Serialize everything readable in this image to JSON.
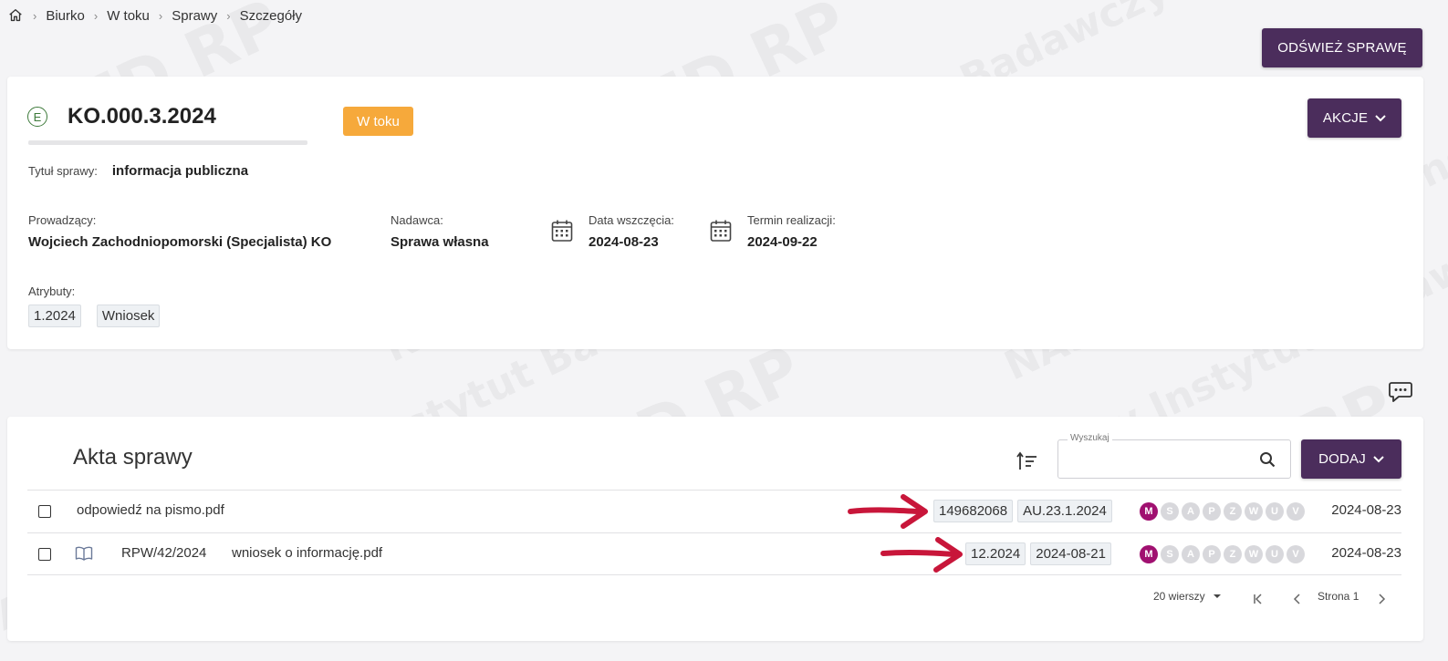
{
  "watermark": {
    "texts": [
      "EZD RP",
      "NASK",
      "NASK – Państwowy Instytut Badawczy"
    ]
  },
  "breadcrumb": {
    "home_icon": "home-icon",
    "items": [
      "Biurko",
      "W toku",
      "Sprawy",
      "Szczegóły"
    ]
  },
  "header": {
    "refresh_label": "ODŚWIEŻ SPRAWĘ"
  },
  "case": {
    "type_letter": "E",
    "number": "KO.000.3.2024",
    "status": "W toku",
    "status_color": "#f6a93b",
    "actions_label": "AKCJE",
    "title_label": "Tytuł sprawy:",
    "title_value": "informacja publiczna",
    "owner_label": "Prowadzący:",
    "owner_value": "Wojciech Zachodniopomorski (Specjalista) KO",
    "sender_label": "Nadawca:",
    "sender_value": "Sprawa własna",
    "start_label": "Data wszczęcia:",
    "start_value": "2024-08-23",
    "deadline_label": "Termin realizacji:",
    "deadline_value": "2024-09-22",
    "attributes_label": "Atrybuty:",
    "attributes": [
      "1.2024",
      "Wniosek"
    ]
  },
  "files": {
    "title": "Akta sprawy",
    "search_label": "Wyszukaj",
    "search_value": "",
    "add_label": "DODAJ",
    "rows": [
      {
        "ref": "",
        "name": "odpowiedź na pismo.pdf",
        "tags": [
          "149682068",
          "AU.23.1.2024"
        ],
        "letters": [
          "M",
          "S",
          "A",
          "P",
          "Z",
          "W",
          "U",
          "V"
        ],
        "date": "2024-08-23"
      },
      {
        "ref": "RPW/42/2024",
        "name": "wniosek o informację.pdf",
        "tags": [
          "12.2024",
          "2024-08-21"
        ],
        "letters": [
          "M",
          "S",
          "A",
          "P",
          "Z",
          "W",
          "U",
          "V"
        ],
        "date": "2024-08-23"
      }
    ],
    "pager": {
      "rows_per_page": "20 wierszy",
      "page_label": "Strona 1"
    }
  },
  "colors": {
    "accent": "#4b2d5c",
    "annotation_arrow": "#c8163a",
    "active_letter": "#a01070"
  }
}
